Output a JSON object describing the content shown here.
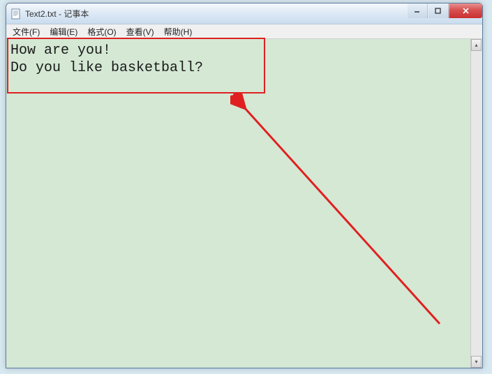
{
  "window": {
    "title": "Text2.txt - 记事本",
    "icon": "notepad-icon"
  },
  "menubar": {
    "items": [
      {
        "label": "文件(F)"
      },
      {
        "label": "编辑(E)"
      },
      {
        "label": "格式(O)"
      },
      {
        "label": "查看(V)"
      },
      {
        "label": "帮助(H)"
      }
    ]
  },
  "editor": {
    "content": "How are you!\nDo you like basketball?"
  },
  "win_controls": {
    "minimize": "–",
    "maximize": "☐",
    "close": "✕"
  },
  "annotation": {
    "box_color": "#e02020"
  }
}
